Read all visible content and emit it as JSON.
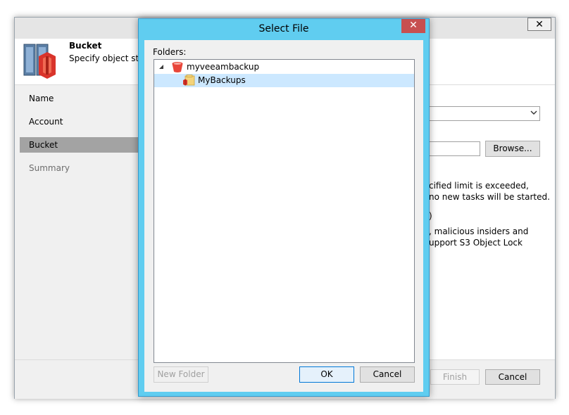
{
  "wizard": {
    "close_glyph": "✕",
    "header": {
      "title": "Bucket",
      "subtitle": "Specify object stora"
    },
    "nav": [
      {
        "label": "Name",
        "state": "normal"
      },
      {
        "label": "Account",
        "state": "normal"
      },
      {
        "label": "Bucket",
        "state": "active"
      },
      {
        "label": "Summary",
        "state": "disabled"
      }
    ],
    "browse_label": "Browse...",
    "text_lines": [
      "cified limit is exceeded,",
      "no new tasks will be started.",
      ")",
      ", malicious insiders and",
      "upport S3 Object Lock"
    ],
    "finish_label": "Finish",
    "cancel_label": "Cancel"
  },
  "dialog": {
    "title": "Select File",
    "close_glyph": "✕",
    "folders_label": "Folders:",
    "tree": [
      {
        "label": "myveeambackup",
        "level": 0,
        "expanded": true,
        "selected": false,
        "icon": "bucket-icon"
      },
      {
        "label": "MyBackups",
        "level": 1,
        "expanded": false,
        "selected": true,
        "icon": "folder-icon"
      }
    ],
    "new_folder_label": "New Folder",
    "ok_label": "OK",
    "cancel_label": "Cancel"
  },
  "colors": {
    "dialog_frame": "#60cdf0",
    "close_red": "#c75050",
    "selection": "#cce8ff",
    "bucket_red": "#e8463a"
  }
}
